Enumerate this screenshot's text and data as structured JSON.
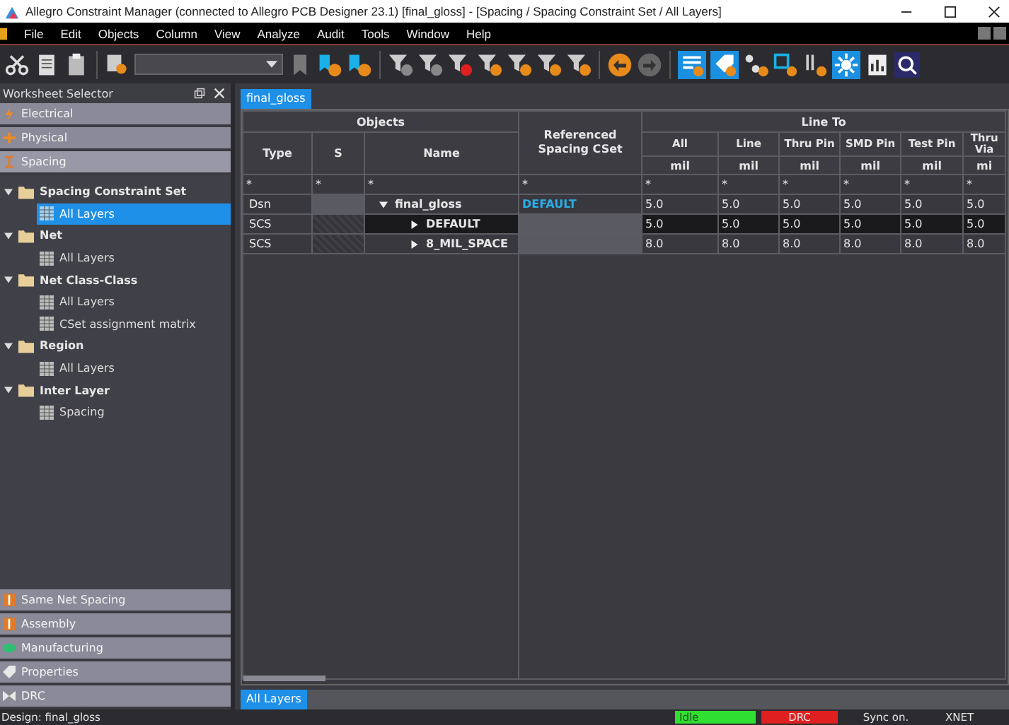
{
  "window": {
    "title": "Allegro Constraint Manager (connected to Allegro PCB Designer 23.1) [final_gloss] - [Spacing / Spacing Constraint Set / All Layers]"
  },
  "menu": [
    "File",
    "Edit",
    "Objects",
    "Column",
    "View",
    "Analyze",
    "Audit",
    "Tools",
    "Window",
    "Help"
  ],
  "worksheet_selector": {
    "title": "Worksheet Selector",
    "top_categories": [
      {
        "label": "Electrical",
        "kind": "electrical",
        "selected": false
      },
      {
        "label": "Physical",
        "kind": "physical",
        "selected": false
      },
      {
        "label": "Spacing",
        "kind": "spacing",
        "selected": true
      }
    ],
    "tree": [
      {
        "label": "Spacing Constraint Set",
        "expanded": true,
        "children": [
          {
            "label": "All Layers",
            "selected": true
          }
        ]
      },
      {
        "label": "Net",
        "expanded": true,
        "children": [
          {
            "label": "All Layers",
            "selected": false
          }
        ]
      },
      {
        "label": "Net Class-Class",
        "expanded": true,
        "children": [
          {
            "label": "All Layers",
            "selected": false
          },
          {
            "label": "CSet assignment matrix",
            "selected": false
          }
        ]
      },
      {
        "label": "Region",
        "expanded": true,
        "children": [
          {
            "label": "All Layers",
            "selected": false
          }
        ]
      },
      {
        "label": "Inter Layer",
        "expanded": true,
        "children": [
          {
            "label": "Spacing",
            "selected": false
          }
        ]
      }
    ],
    "bottom_categories": [
      {
        "label": "Same Net Spacing",
        "kind": "spacing",
        "selected": false
      },
      {
        "label": "Assembly",
        "kind": "spacing",
        "selected": false
      },
      {
        "label": "Manufacturing",
        "kind": "manufacturing",
        "selected": false
      },
      {
        "label": "Properties",
        "kind": "properties",
        "selected": false
      },
      {
        "label": "DRC",
        "kind": "drc",
        "selected": false
      }
    ]
  },
  "design_tab": {
    "label": "final_gloss",
    "selected": true
  },
  "table": {
    "group_objects": "Objects",
    "group_line_to": "Line To",
    "ref_header": "Referenced Spacing CSet",
    "object_columns": [
      "Type",
      "S",
      "Name"
    ],
    "value_columns": [
      {
        "label": "All",
        "unit": "mil"
      },
      {
        "label": "Line",
        "unit": "mil"
      },
      {
        "label": "Thru Pin",
        "unit": "mil"
      },
      {
        "label": "SMD Pin",
        "unit": "mil"
      },
      {
        "label": "Test Pin",
        "unit": "mil"
      },
      {
        "label": "Thru Via",
        "unit": "mi"
      }
    ],
    "filter": "*",
    "rows": [
      {
        "type": "Dsn",
        "name": "final_gloss",
        "expanded": true,
        "selected": false,
        "ref": "DEFAULT",
        "values": [
          "5.0",
          "5.0",
          "5.0",
          "5.0",
          "5.0",
          "5.0"
        ],
        "children": [
          {
            "type": "SCS",
            "name": "DEFAULT",
            "expanded": false,
            "selected": true,
            "values": [
              "5.0",
              "5.0",
              "5.0",
              "5.0",
              "5.0",
              "5.0"
            ]
          },
          {
            "type": "SCS",
            "name": "8_MIL_SPACE",
            "expanded": false,
            "selected": false,
            "values": [
              "8.0",
              "8.0",
              "8.0",
              "8.0",
              "8.0",
              "8.0"
            ]
          }
        ]
      }
    ]
  },
  "sheet_tab": {
    "label": "All Layers",
    "selected": true
  },
  "status_bar": {
    "design": "Design: final_gloss",
    "state": "Idle",
    "drc": "DRC",
    "sync": "Sync on.",
    "mode": "XNET"
  }
}
